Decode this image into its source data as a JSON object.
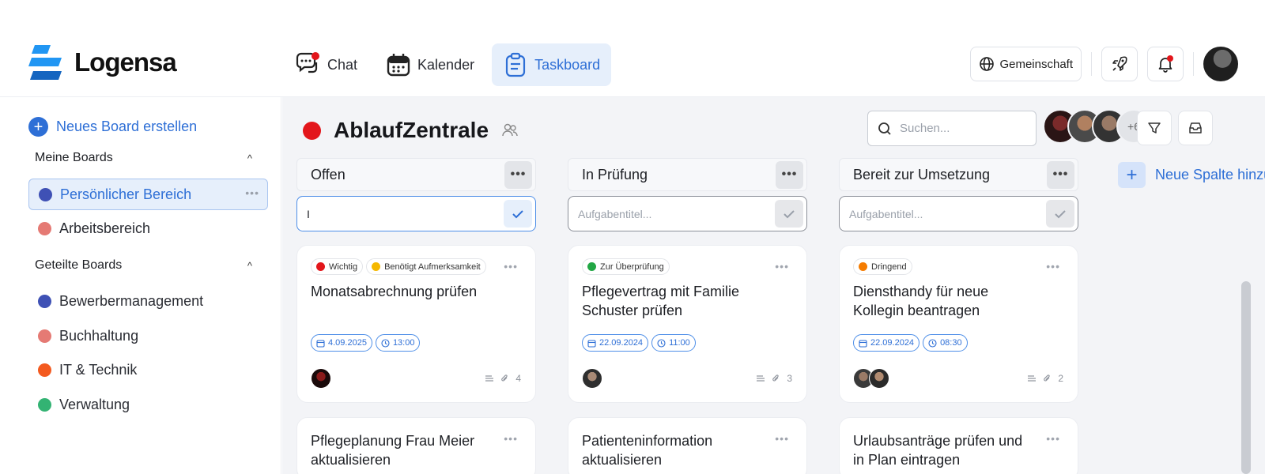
{
  "app": {
    "name": "Logensa"
  },
  "nav": [
    {
      "label": "Chat",
      "icon": "chat-icon"
    },
    {
      "label": "Kalender",
      "icon": "calendar-icon"
    },
    {
      "label": "Taskboard",
      "icon": "clipboard-icon"
    }
  ],
  "header": {
    "community_label": "Gemeinschaft"
  },
  "sidebar": {
    "new_board_label": "Neues Board erstellen",
    "my_boards_title": "Meine Boards",
    "my_boards": [
      {
        "label": "Persönlicher Bereich",
        "color": "#3f51b5"
      },
      {
        "label": "Arbeitsbereich",
        "color": "#e57a74"
      }
    ],
    "shared_boards_title": "Geteilte Boards",
    "shared_boards": [
      {
        "label": "Bewerbermanagement",
        "color": "#3f51b5"
      },
      {
        "label": "Buchhaltung",
        "color": "#e57a74"
      },
      {
        "label": "IT & Technik",
        "color": "#f35a1f"
      },
      {
        "label": "Verwaltung",
        "color": "#33b373"
      }
    ]
  },
  "board": {
    "title": "AblaufZentrale",
    "color": "#e3161b",
    "search_placeholder": "Suchen...",
    "members_more": "+6",
    "add_column_label": "Neue Spalte hinzufügen"
  },
  "columns": [
    {
      "title": "Offen",
      "input_value": "I",
      "input_placeholder": "Aufgabentitel...",
      "cards": [
        {
          "tags": [
            {
              "label": "Wichtig",
              "color": "#e3161b"
            },
            {
              "label": "Benötigt Aufmerksamkeit",
              "color": "#f5b800"
            }
          ],
          "title": "Monatsabrechnung prüfen",
          "date": "4.09.2025",
          "time": "13:00",
          "attachments": "4",
          "avatars": 1
        },
        {
          "title": "Pflegeplanung Frau Meier aktualisieren"
        }
      ]
    },
    {
      "title": "In Prüfung",
      "input_value": "",
      "input_placeholder": "Aufgabentitel...",
      "cards": [
        {
          "tags": [
            {
              "label": "Zur Überprüfung",
              "color": "#22a745"
            }
          ],
          "title": "Pflegevertrag mit Familie Schuster prüfen",
          "date": "22.09.2024",
          "time": "11:00",
          "attachments": "3",
          "avatars": 1
        },
        {
          "title": "Patienteninformation aktualisieren"
        }
      ]
    },
    {
      "title": "Bereit zur Umsetzung",
      "input_value": "",
      "input_placeholder": "Aufgabentitel...",
      "cards": [
        {
          "tags": [
            {
              "label": "Dringend",
              "color": "#f57c00"
            }
          ],
          "title": "Diensthandy für neue Kollegin beantragen",
          "date": "22.09.2024",
          "time": "08:30",
          "attachments": "2",
          "avatars": 2
        },
        {
          "title": "Urlaubsanträge prüfen und in Plan eintragen"
        }
      ]
    }
  ]
}
